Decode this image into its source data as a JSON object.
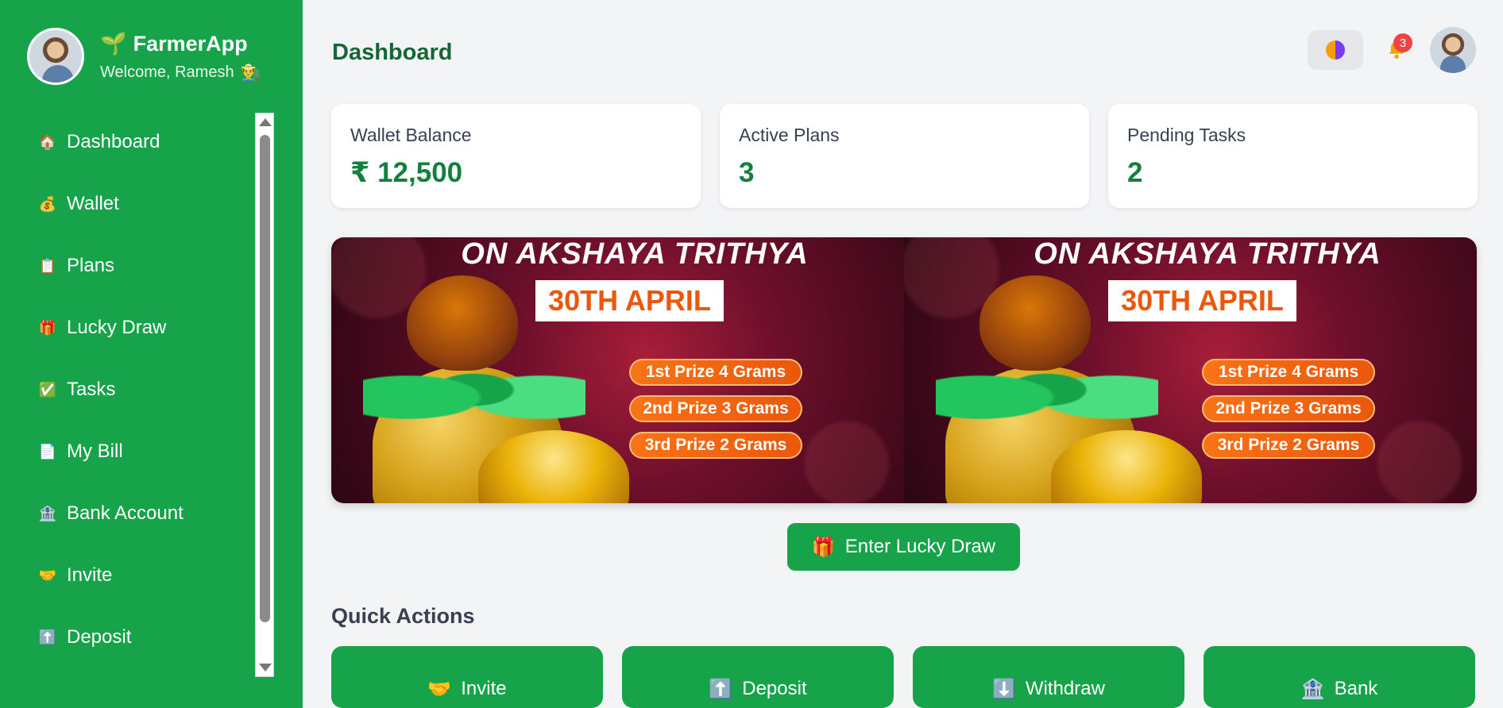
{
  "brand": {
    "name": "FarmerApp",
    "welcome": "Welcome, Ramesh",
    "logo_icon": "🌱",
    "welcome_icon": "👨‍🌾"
  },
  "sidebar": {
    "items": [
      {
        "label": "Dashboard",
        "icon": "🏠"
      },
      {
        "label": "Wallet",
        "icon": "💰"
      },
      {
        "label": "Plans",
        "icon": "📋"
      },
      {
        "label": "Lucky Draw",
        "icon": "🎁"
      },
      {
        "label": "Tasks",
        "icon": "✅"
      },
      {
        "label": "My Bill",
        "icon": "📄"
      },
      {
        "label": "Bank Account",
        "icon": "🏦"
      },
      {
        "label": "Invite",
        "icon": "🤝"
      },
      {
        "label": "Deposit",
        "icon": "⬆️"
      }
    ]
  },
  "header": {
    "title": "Dashboard",
    "notification_count": "3"
  },
  "stats": [
    {
      "label": "Wallet Balance",
      "value": "₹ 12,500"
    },
    {
      "label": "Active Plans",
      "value": "3"
    },
    {
      "label": "Pending Tasks",
      "value": "2"
    }
  ],
  "banner": {
    "headline": "ON AKSHAYA TRITHYA",
    "date": "30TH APRIL",
    "prizes": [
      "1st Prize 4 Grams",
      "2nd Prize 3 Grams",
      "3rd Prize 2 Grams"
    ]
  },
  "lucky_draw_button": {
    "label": "Enter Lucky Draw",
    "icon": "🎁"
  },
  "quick_actions": {
    "title": "Quick Actions",
    "items": [
      {
        "label": "Invite",
        "icon": "🤝"
      },
      {
        "label": "Deposit",
        "icon": "⬆️"
      },
      {
        "label": "Withdraw",
        "icon": "⬇️"
      },
      {
        "label": "Bank",
        "icon": "🏦"
      }
    ]
  },
  "colors": {
    "sidebar_bg": "#16a34a",
    "accent_text": "#15803d",
    "badge": "#ef4444",
    "banner_orange": "#ea580c"
  }
}
